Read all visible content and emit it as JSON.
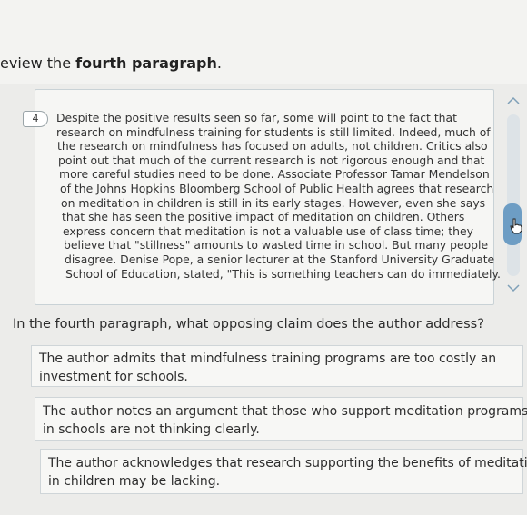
{
  "instruction": {
    "prefix": "eview the ",
    "bold": "fourth paragraph",
    "suffix": "."
  },
  "passage": {
    "paragraph_number": "4",
    "lines": [
      "Despite the positive results seen so far, some will point to the fact that",
      "research on mindfulness training for students is still limited. Indeed, much of",
      "the research on mindfulness has focused on adults, not children. Critics also",
      "point out that much of the current research is not rigorous enough and that",
      "more careful studies need to be done. Associate Professor Tamar Mendelson",
      "of the Johns Hopkins Bloomberg School of Public Health agrees that research",
      "on meditation in children is still in its early stages. However, even she says",
      "that she has seen the positive impact of meditation on children. Others",
      "express concern that meditation is not a valuable use of class time; they",
      "believe that \"stillness\" amounts to wasted time in school. But many people",
      "disagree. Denise Pope, a senior lecturer at the Stanford University Graduate",
      "School of Education, stated, \"This is something teachers can do immediately."
    ]
  },
  "scrollbar": {
    "up_icon": "chevron-up-icon",
    "down_icon": "chevron-down-icon"
  },
  "question": "In the fourth paragraph, what opposing claim does the author address?",
  "options": [
    {
      "lines": [
        "The author admits that mindfulness training programs are too costly an",
        "investment for schools."
      ]
    },
    {
      "lines": [
        "The author notes an argument that those who support meditation programs",
        "in schools are not thinking clearly."
      ]
    },
    {
      "lines": [
        "The author acknowledges that research supporting the benefits of meditation",
        "in children may be lacking."
      ]
    }
  ]
}
